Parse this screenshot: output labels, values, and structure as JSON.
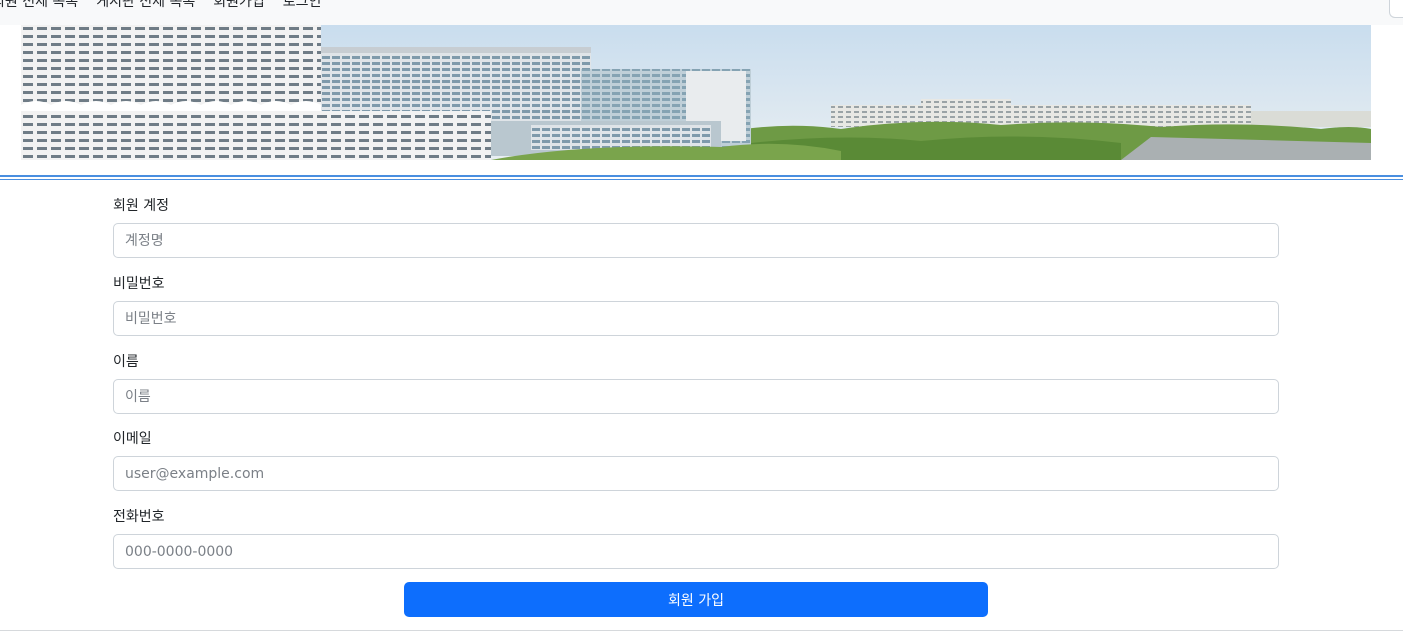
{
  "nav": {
    "items": [
      {
        "label": "회원 전체 목록"
      },
      {
        "label": "게시판 전체 목록"
      },
      {
        "label": "회원가입"
      },
      {
        "label": "로그인"
      }
    ]
  },
  "banner": {
    "icon": "hospital-building-photo"
  },
  "form": {
    "fields": [
      {
        "label": "회원 계정",
        "placeholder": "계정명"
      },
      {
        "label": "비밀번호",
        "placeholder": "비밀번호"
      },
      {
        "label": "이름",
        "placeholder": "이름"
      },
      {
        "label": "이메일",
        "placeholder": "user@example.com"
      },
      {
        "label": "전화번호",
        "placeholder": "000-0000-0000"
      }
    ],
    "submit_label": "회원 가입"
  },
  "colors": {
    "accent": "#0d6efd",
    "divider": "#4a8fe0"
  }
}
